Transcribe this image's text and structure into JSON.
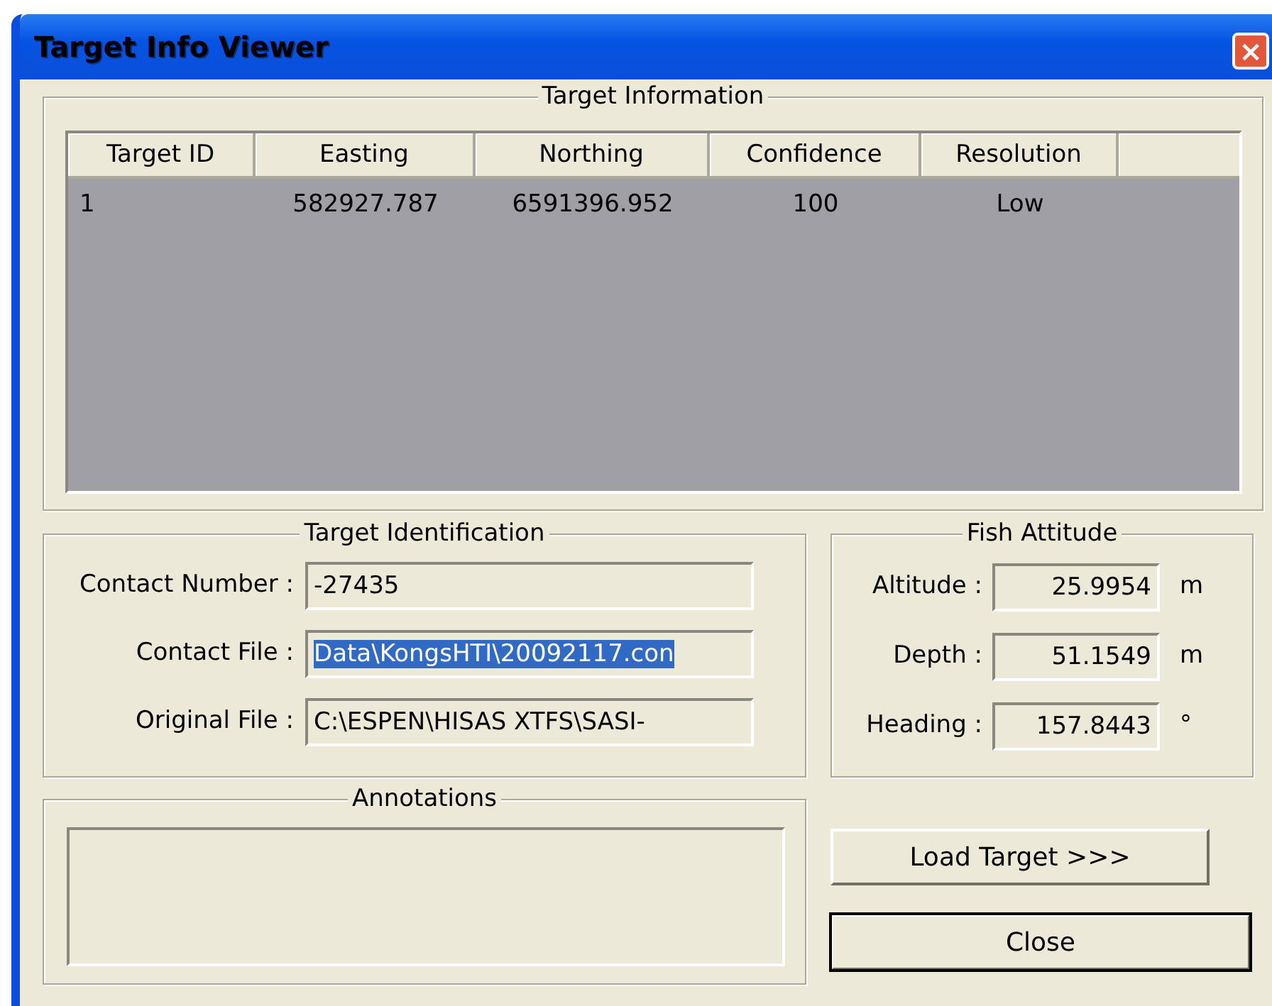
{
  "window": {
    "title": "Target Info Viewer",
    "close": "×"
  },
  "target_information": {
    "title": "Target Information",
    "table": {
      "columns": [
        "Target ID",
        "Easting",
        "Northing",
        "Confidence",
        "Resolution"
      ],
      "rows": [
        [
          "1",
          "582927.787",
          "6591396.952",
          "100",
          "Low"
        ]
      ]
    }
  },
  "target_identification": {
    "title": "Target Identification",
    "fields": [
      {
        "label": "Contact Number :",
        "value": "-27435",
        "highlighted": false
      },
      {
        "label": "Contact File :",
        "value": "Data\\KongsHTI\\20092117.con",
        "highlighted": true
      },
      {
        "label": "Original File :",
        "value": "C:\\ESPEN\\HISAS XTFS\\SASI-",
        "highlighted": false
      }
    ]
  },
  "fish_attitude": {
    "title": "Fish Attitude",
    "fields": [
      {
        "label": "Altitude :",
        "value": "25.9954",
        "unit": "m"
      },
      {
        "label": "Depth :",
        "value": "51.1549",
        "unit": "m"
      },
      {
        "label": "Heading :",
        "value": "157.8443",
        "unit": "°"
      }
    ]
  },
  "annotations": {
    "title": "Annotations"
  },
  "buttons": [
    {
      "label": "Load Target >>>",
      "default": false
    },
    {
      "label": "Close",
      "default": true
    }
  ]
}
